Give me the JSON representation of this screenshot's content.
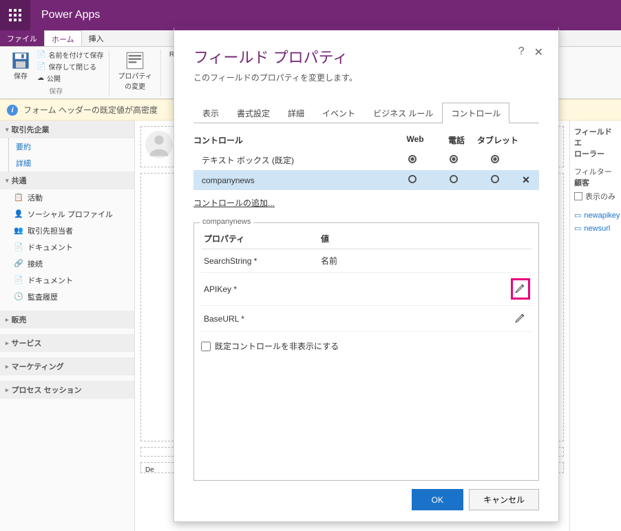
{
  "header": {
    "app_name": "Power Apps"
  },
  "ribbon": {
    "tabs": {
      "file": "ファイル",
      "home": "ホーム",
      "insert": "挿入"
    },
    "save": "保存",
    "save_as": "名前を付けて保存",
    "save_close": "保存して閉じる",
    "publish": "公開",
    "group_save": "保存",
    "properties_change": "プロパティ\nの変更",
    "re": "Re"
  },
  "info_bar": "フォーム ヘッダーの既定値が高密度",
  "left_nav": {
    "s1": "取引先企業",
    "summary": "要約",
    "detail": "詳細",
    "s2": "共通",
    "activity": "活動",
    "social": "ソーシャル プロファイル",
    "contacts": "取引先担当者",
    "docs": "ドキュメント",
    "connections": "接続",
    "docs2": "ドキュメント",
    "audit": "監査履歴",
    "s3": "販売",
    "s4": "サービス",
    "s5": "マーケティング",
    "s6": "プロセス セッション"
  },
  "right": {
    "hdr": "フィールド エ\nローラー",
    "filter": "フィルター",
    "filter_val": "顧客",
    "show_only": "表示のみ",
    "i1": "newapikey",
    "i2": "newsurl"
  },
  "center": {
    "de": "De"
  },
  "modal": {
    "title": "フィールド プロパティ",
    "subtitle": "このフィールドのプロパティを変更します。",
    "tabs": {
      "display": "表示",
      "format": "書式設定",
      "detail": "詳細",
      "event": "イベント",
      "bizrule": "ビジネス ルール",
      "control": "コントロール"
    },
    "cols": {
      "control": "コントロール",
      "web": "Web",
      "phone": "電話",
      "tablet": "タブレット"
    },
    "rows": {
      "textbox": "テキスト ボックス (既定)",
      "companynews": "companynews"
    },
    "add_control": "コントロールの追加...",
    "propbox_legend": "companynews",
    "prop_hdr_name": "プロパティ",
    "prop_hdr_val": "値",
    "props": {
      "searchstring": {
        "name": "SearchString *",
        "val": "名前"
      },
      "apikey": {
        "name": "APIKey *",
        "val": ""
      },
      "baseurl": {
        "name": "BaseURL *",
        "val": ""
      }
    },
    "hide_default": "既定コントロールを非表示にする",
    "ok": "OK",
    "cancel": "キャンセル"
  }
}
